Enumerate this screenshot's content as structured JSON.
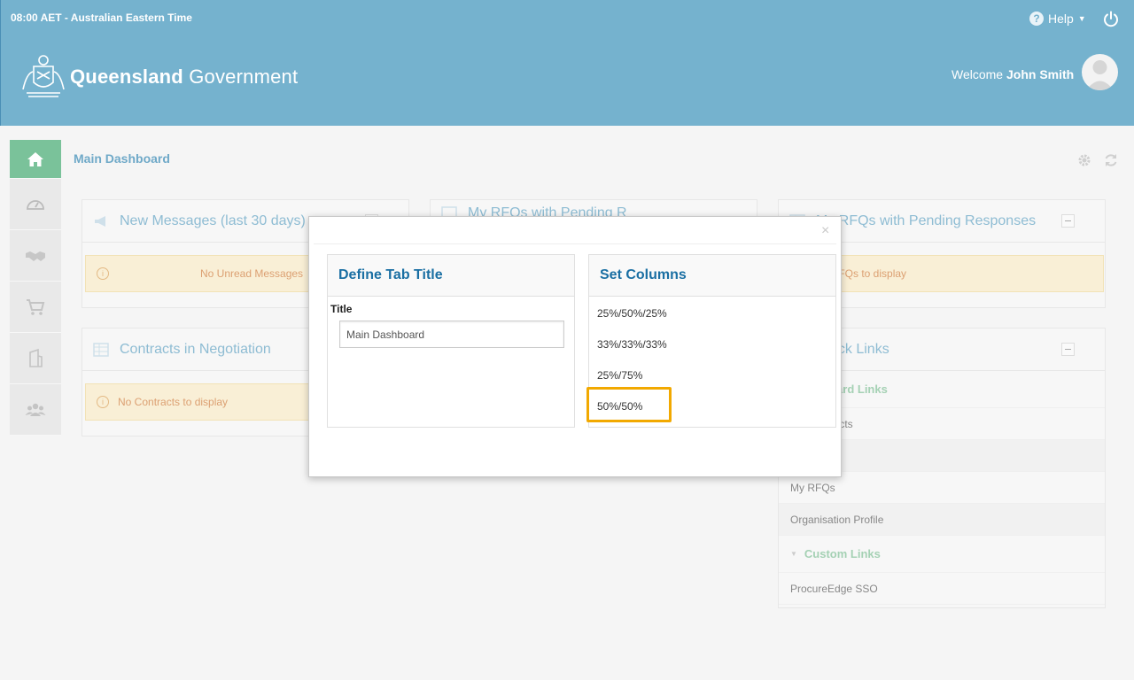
{
  "header": {
    "timezone": "08:00 AET - Australian Eastern Time",
    "help_label": "Help",
    "logo_bold": "Queensland",
    "logo_light": "Government",
    "welcome_prefix": "Welcome",
    "user_name": "John Smith"
  },
  "sidebar": {
    "items": [
      {
        "icon": "home-icon"
      },
      {
        "icon": "dashboard-gauge-icon"
      },
      {
        "icon": "handshake-icon"
      },
      {
        "icon": "cart-icon"
      },
      {
        "icon": "building-icon"
      },
      {
        "icon": "users-icon"
      }
    ]
  },
  "main": {
    "title": "Main Dashboard"
  },
  "widgets": {
    "new_messages": {
      "title": "New Messages (last 30 days)",
      "alert": "No Unread Messages"
    },
    "contracts": {
      "title": "Contracts in Negotiation",
      "alert": "No Contracts to display"
    },
    "rfqs_middle": {
      "title": "My RFQs with Pending R"
    },
    "rfqs_right": {
      "title": "My RFQs with Pending Responses",
      "alert": "No RFQs to display"
    },
    "quick_links": {
      "title": "Quick Links",
      "standard_section": "Standard Links",
      "links": [
        "My Contracts",
        "",
        "My RFQs",
        "Organisation Profile"
      ],
      "custom_section": "Custom Links",
      "custom_links": [
        "ProcureEdge SSO"
      ]
    }
  },
  "modal": {
    "close_glyph": "×",
    "tab_title_panel": {
      "heading": "Define Tab Title",
      "field_label": "Title",
      "field_value": "Main Dashboard"
    },
    "columns_panel": {
      "heading": "Set Columns",
      "options": [
        "25%/50%/25%",
        "33%/33%/33%",
        "25%/75%",
        "50%/50%"
      ]
    }
  }
}
